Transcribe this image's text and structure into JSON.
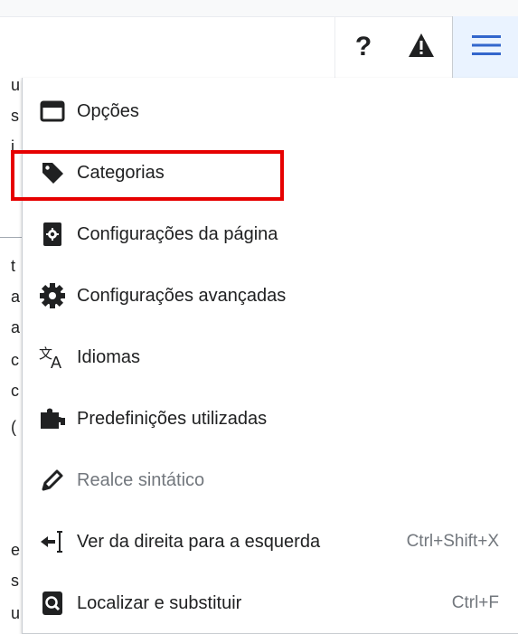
{
  "toolbar": {
    "help_label": "?",
    "notice_icon": "warning-icon",
    "menu_icon": "hamburger-menu-icon"
  },
  "background_fragments": [
    "u",
    "s",
    "i",
    "t",
    "a",
    "a",
    "c",
    "c",
    "(",
    "e",
    "s",
    "u"
  ],
  "menu": {
    "items": [
      {
        "label": "Opções",
        "icon": "window-icon",
        "shortcut": "",
        "disabled": false
      },
      {
        "label": "Categorias",
        "icon": "tag-icon",
        "shortcut": "",
        "disabled": false
      },
      {
        "label": "Configurações da página",
        "icon": "page-settings-icon",
        "shortcut": "",
        "disabled": false
      },
      {
        "label": "Configurações avançadas",
        "icon": "gear-icon",
        "shortcut": "",
        "disabled": false
      },
      {
        "label": "Idiomas",
        "icon": "language-icon",
        "shortcut": "",
        "disabled": false
      },
      {
        "label": "Predefinições utilizadas",
        "icon": "puzzle-icon",
        "shortcut": "",
        "disabled": false
      },
      {
        "label": "Realce sintático",
        "icon": "pencil-icon",
        "shortcut": "",
        "disabled": true
      },
      {
        "label": "Ver da direita para a esquerda",
        "icon": "text-direction-icon",
        "shortcut": "Ctrl+Shift+X",
        "disabled": false
      },
      {
        "label": "Localizar e substituir",
        "icon": "find-replace-icon",
        "shortcut": "Ctrl+F",
        "disabled": false
      }
    ]
  },
  "highlight": {
    "target": "Categorias",
    "color": "#e60000"
  }
}
